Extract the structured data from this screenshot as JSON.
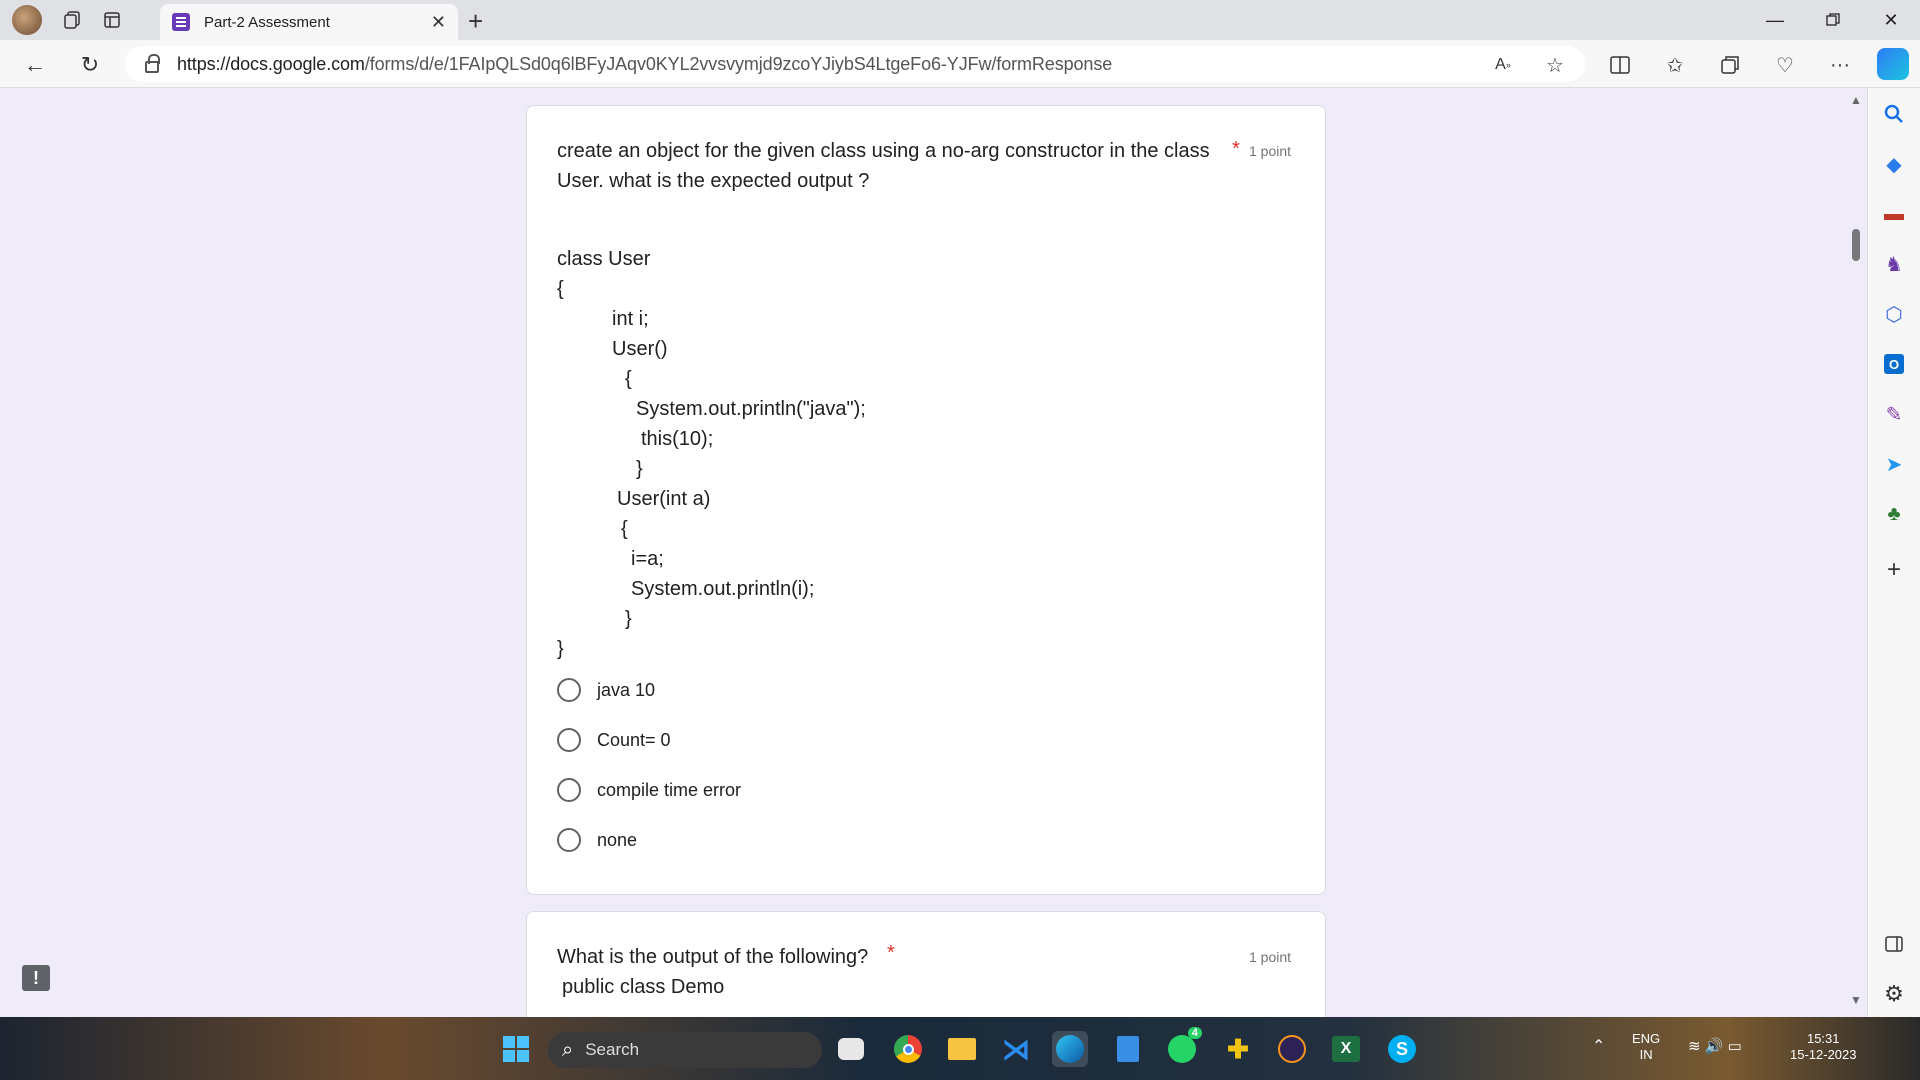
{
  "browser": {
    "tab_title": "Part-2 Assessment",
    "url_host": "https://docs.google.com",
    "url_path": "/forms/d/e/1FAIpQLSd0q6lBFyJAqv0KYL2vvsvymjd9zcoYJiybS4LtgeFo6-YJFw/formResponse"
  },
  "question1": {
    "title": "create an object for the given class using a no-arg constructor in the class User. what is the expected output ?",
    "required_mark": "*",
    "points": "1 point",
    "code": [
      "class User",
      "{",
      "int i;",
      "User()",
      "{",
      "System.out.println(\"java\");",
      "this(10);",
      "}",
      "User(int a)",
      "{",
      "i=a;",
      "System.out.println(i);",
      "}",
      "}"
    ],
    "options": [
      "java 10",
      "Count= 0",
      "compile time error",
      "none"
    ]
  },
  "question2": {
    "title": "What is the output of the following?",
    "required_mark": "*",
    "points": "1 point",
    "code_first_line": "public class Demo"
  },
  "taskbar": {
    "search_placeholder": "Search",
    "whatsapp_badge": "4",
    "lang": "ENG",
    "region": "IN",
    "time": "15:31",
    "date": "15-12-2023"
  }
}
